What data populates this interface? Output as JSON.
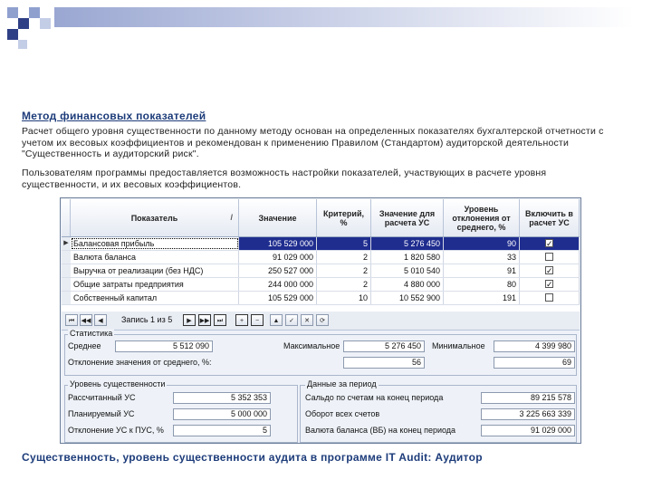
{
  "heading": "Метод финансовых показателей",
  "paragraph1": "Расчет общего уровня существенности по данному методу основан на определенных показателях бухгалтерской отчетности с учетом их весовых коэффициентов и рекомендован к применению Правилом (Стандартом) аудиторской деятельности \"Существенность и аудиторский риск\".",
  "paragraph2": "Пользователям программы предоставляется возможность настройки показателей, участвующих в расчете уровня существенности, и их весовых коэффициентов.",
  "table": {
    "headers": {
      "indicator": "Показатель",
      "sort_mark": "/",
      "value": "Значение",
      "criterion": "Критерий, %",
      "calc_value": "Значение для расчета УС",
      "deviation": "Уровень отклонения от среднего, %",
      "include": "Включить в расчет УС"
    },
    "rows": [
      {
        "indicator": "Балансовая прибыль",
        "value": "105 529 000",
        "criterion": "5",
        "calc": "5 276 450",
        "dev": "90",
        "include": true
      },
      {
        "indicator": "Валюта баланса",
        "value": "91 029 000",
        "criterion": "2",
        "calc": "1 820 580",
        "dev": "33",
        "include": false
      },
      {
        "indicator": "Выручка от реализации (без НДС)",
        "value": "250 527 000",
        "criterion": "2",
        "calc": "5 010 540",
        "dev": "91",
        "include": true
      },
      {
        "indicator": "Общие затраты предприятия",
        "value": "244 000 000",
        "criterion": "2",
        "calc": "4 880 000",
        "dev": "80",
        "include": true
      },
      {
        "indicator": "Собственный капитал",
        "value": "105 529 000",
        "criterion": "10",
        "calc": "10 552 900",
        "dev": "191",
        "include": false
      }
    ]
  },
  "navigator": {
    "record_text": "Запись 1 из 5",
    "buttons": [
      "⏮",
      "◀◀",
      "◀",
      "▶",
      "▶▶",
      "⏭",
      "+",
      "−",
      "▲",
      "✓",
      "✕",
      "⟳"
    ]
  },
  "statistics": {
    "title": "Статистика",
    "mean_label": "Среднее",
    "mean_value": "5 512 090",
    "max_label": "Максимальное",
    "max_value": "5 276 450",
    "min_label": "Минимальное",
    "min_value": "4 399 980",
    "deviation_label": "Отклонение значения от среднего, %:",
    "deviation_max": "56",
    "deviation_min": "69"
  },
  "materiality": {
    "title": "Уровень существенности",
    "calc_label": "Рассчитанный УС",
    "calc_value": "5 352 353",
    "planned_label": "Планируемый УС",
    "planned_value": "5 000 000",
    "deviation_label": "Отклонение УС к ПУС, %",
    "deviation_value": "5"
  },
  "period": {
    "title": "Данные за период",
    "balance_label": "Сальдо по счетам на конец периода",
    "balance_value": "89 215 578",
    "turnover_label": "Оборот всех счетов",
    "turnover_value": "3 225 663 339",
    "currency_label": "Валюта баланса (ВБ) на конец периода",
    "currency_value": "91 029 000"
  },
  "caption": "Существенность, уровень существенности аудита в программе IT Audit: Аудитор",
  "colors": {
    "accent": "#1d3c7a",
    "selection": "#1f2d8f",
    "deco_blue": "#7b8fc6"
  }
}
